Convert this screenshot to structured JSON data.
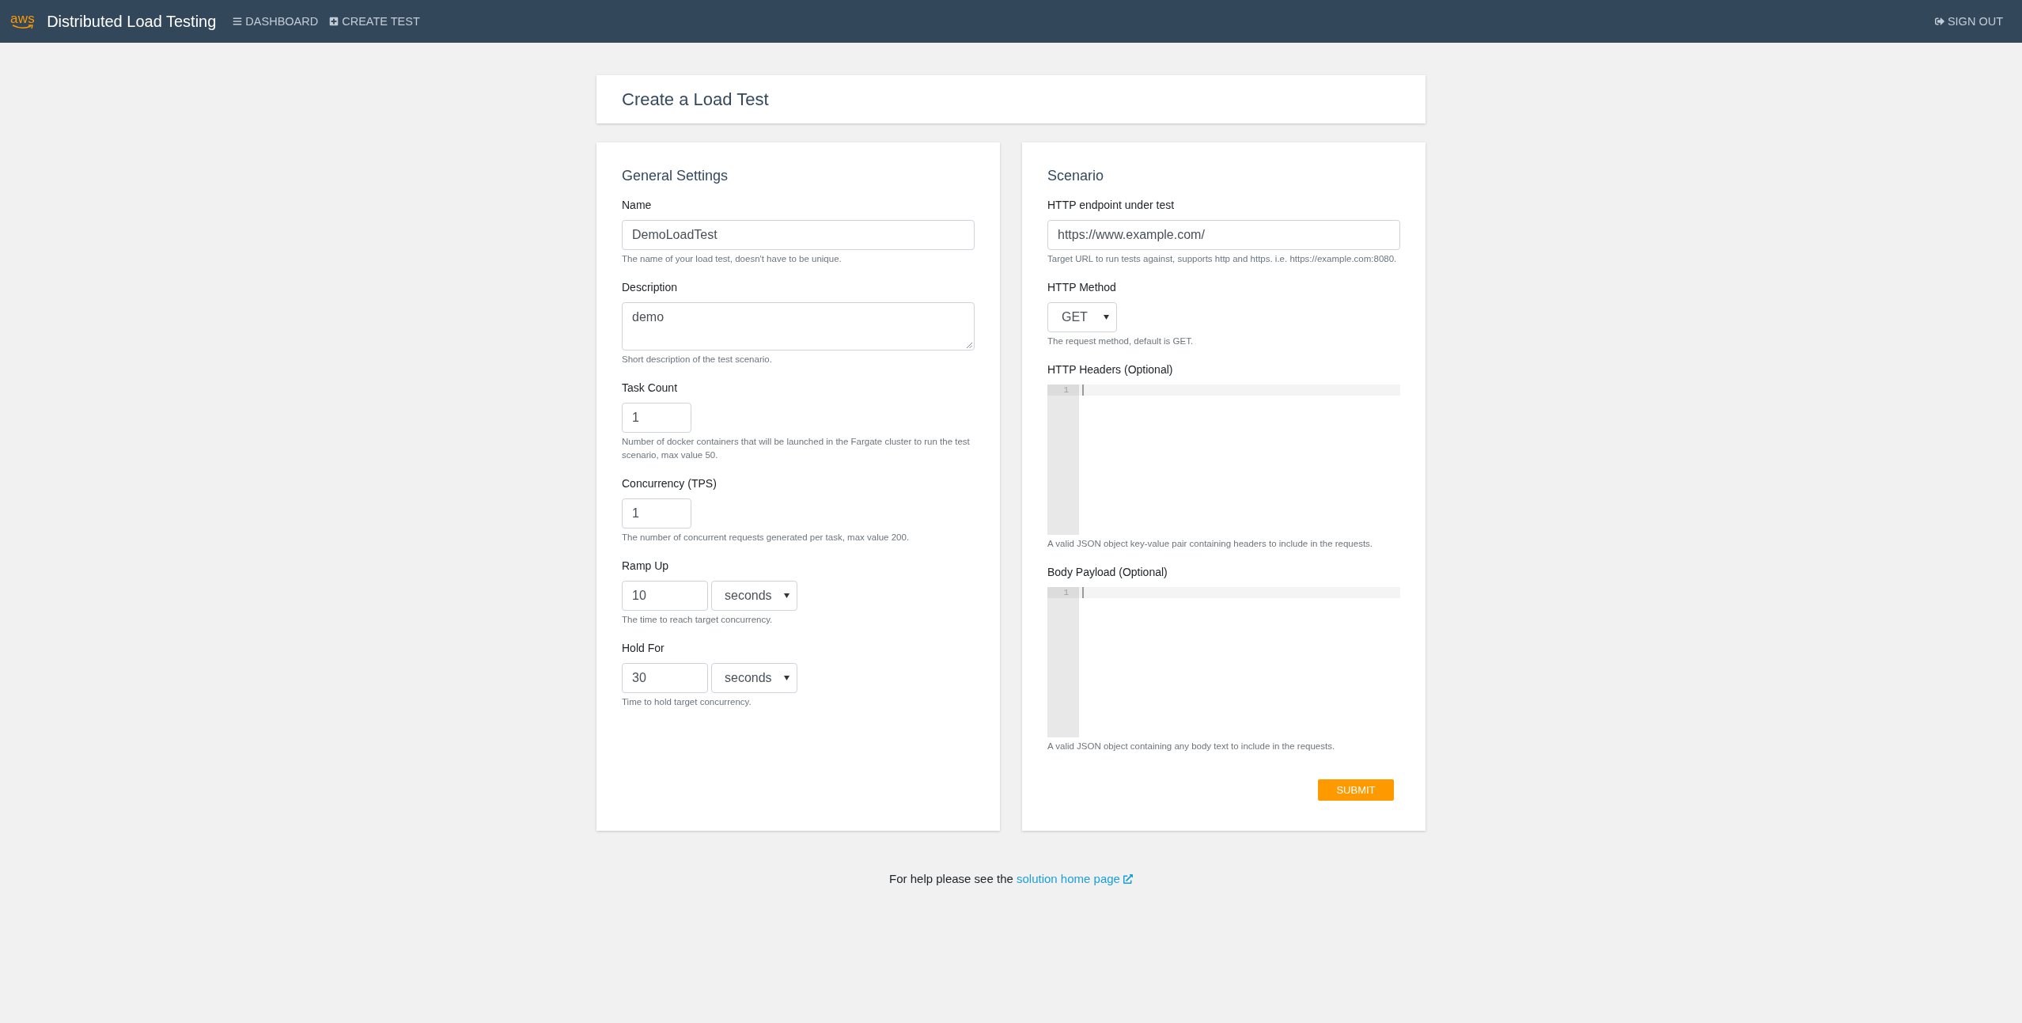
{
  "navbar": {
    "logo": "aws",
    "title": "Distributed Load Testing",
    "links": [
      {
        "label": "DASHBOARD"
      },
      {
        "label": "CREATE TEST"
      }
    ],
    "sign_out": "SIGN OUT"
  },
  "page_header": {
    "title": "Create a Load Test"
  },
  "general_settings": {
    "title": "General Settings",
    "fields": [
      {
        "kind": "text",
        "label": "Name",
        "value": "DemoLoadTest",
        "help": "The name of your load test, doesn't have to be unique."
      },
      {
        "kind": "textarea",
        "label": "Description",
        "value": "demo",
        "help": "Short description of the test scenario."
      },
      {
        "kind": "number",
        "label": "Task Count",
        "value": "1",
        "help": "Number of docker containers that will be launched in the Fargate cluster to run the test scenario, max value 50."
      },
      {
        "kind": "number",
        "label": "Concurrency (TPS)",
        "value": "1",
        "help": "The number of concurrent requests generated per task, max value 200."
      },
      {
        "kind": "duration",
        "label": "Ramp Up",
        "value": "10",
        "unit": "seconds",
        "help": "The time to reach target concurrency."
      },
      {
        "kind": "duration",
        "label": "Hold For",
        "value": "30",
        "unit": "seconds",
        "help": "Time to hold target concurrency."
      }
    ]
  },
  "scenario": {
    "title": "Scenario",
    "fields": [
      {
        "kind": "text",
        "label": "HTTP endpoint under test",
        "value": "https://www.example.com/",
        "help": "Target URL to run tests against, supports http and https. i.e. https://example.com:8080."
      },
      {
        "kind": "select",
        "label": "HTTP Method",
        "value": "GET",
        "help": "The request method, default is GET."
      },
      {
        "kind": "code",
        "label": "HTTP Headers (Optional)",
        "line_numbers": [
          "1"
        ],
        "help": "A valid JSON object key-value pair containing headers to include in the requests."
      },
      {
        "kind": "code",
        "label": "Body Payload (Optional)",
        "line_numbers": [
          "1"
        ],
        "help": "A valid JSON object containing any body text to include in the requests."
      }
    ],
    "submit": "SUBMIT"
  },
  "footer": {
    "text": "For help please see the",
    "link": "solution home page"
  }
}
